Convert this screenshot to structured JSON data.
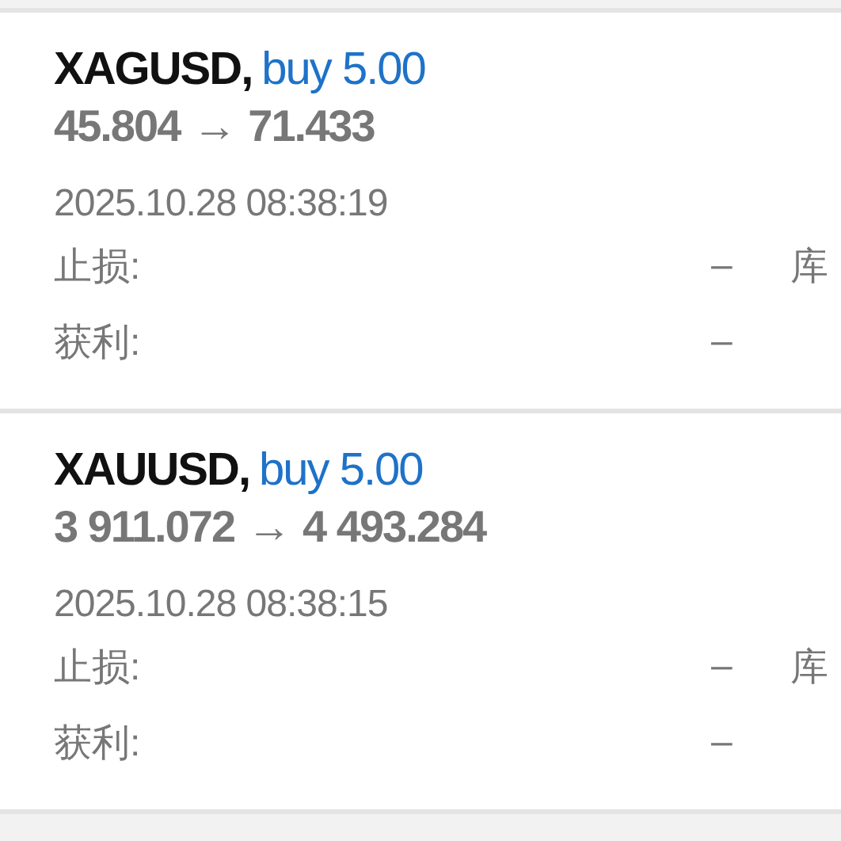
{
  "trades": [
    {
      "symbol": "XAGUSD,",
      "side": "buy 5.00",
      "open_price": "45.804",
      "arrow": "→",
      "close_price": "71.433",
      "time": "2025.10.28 08:38:19",
      "fields": [
        {
          "label": "止损:",
          "value": "–",
          "extra": "库"
        },
        {
          "label": "获利:",
          "value": "–"
        }
      ]
    },
    {
      "symbol": "XAUUSD,",
      "side": "buy 5.00",
      "open_price": "3 911.072",
      "arrow": "→",
      "close_price": "4 493.284",
      "time": "2025.10.28 08:38:15",
      "fields": [
        {
          "label": "止损:",
          "value": "–",
          "extra": "库"
        },
        {
          "label": "获利:",
          "value": "–"
        }
      ]
    }
  ]
}
